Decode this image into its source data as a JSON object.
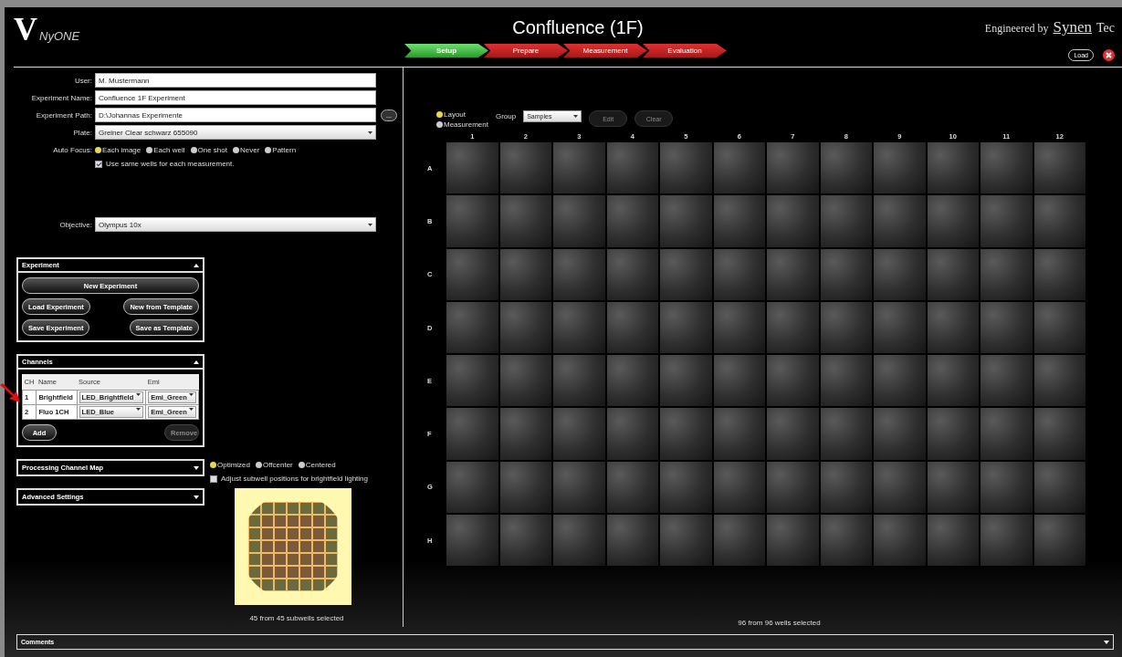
{
  "header": {
    "logo_mark": "V",
    "logo": "NyONE",
    "title": "Confluence (1F)",
    "brand_prefix": "Engineered by",
    "brand_first": "Synen",
    "brand_second": "Tec",
    "load_button": "Load"
  },
  "steps": [
    {
      "label": "Setup",
      "selected": true
    },
    {
      "label": "Prepare",
      "selected": false
    },
    {
      "label": "Measurement",
      "selected": false
    },
    {
      "label": "Evaluation",
      "selected": false
    }
  ],
  "form": {
    "fields": [
      {
        "label": "User:",
        "value": "M. Mustermann",
        "kind": "text"
      },
      {
        "label": "Experiment Name:",
        "value": "Confluence 1F Experiment",
        "kind": "text"
      },
      {
        "label": "Experiment Path:",
        "value": "D:\\Johannas Experimente",
        "kind": "path",
        "button": "..."
      },
      {
        "label": "Plate:",
        "value": "Greiner Clear schwarz 655090",
        "kind": "select"
      }
    ],
    "auto_focus": {
      "label": "Auto Focus:",
      "options": [
        {
          "label": "Each image",
          "selected": true
        },
        {
          "label": "Each well",
          "selected": false
        },
        {
          "label": "One shot",
          "selected": false
        },
        {
          "label": "Never",
          "selected": false
        },
        {
          "label": "Pattern",
          "selected": false
        }
      ]
    },
    "same_wells": {
      "label": "Use same wells for each measurement.",
      "checked": true
    },
    "objective": {
      "label": "Objective:",
      "value": "Olympus 10x"
    }
  },
  "experiment_panel": {
    "title": "Experiment",
    "expanded": true,
    "buttons": [
      "New Experiment",
      "Load Experiment",
      "New from Template",
      "Save Experiment",
      "Save as Template"
    ]
  },
  "channels_panel": {
    "title": "Channels",
    "expanded": true,
    "columns": [
      "CH",
      "Name",
      "Source",
      "Emi"
    ],
    "rows": [
      {
        "ch": "1",
        "name": "Brightfield",
        "source": "LED_Brightfield",
        "emi": "Emi_Green"
      },
      {
        "ch": "2",
        "name": "Fluo 1CH",
        "source": "LED_Blue",
        "emi": "Emi_Green"
      }
    ],
    "add": {
      "label": "Add"
    },
    "remove": {
      "label": "Remove",
      "disabled": true
    }
  },
  "collapsed_panels": [
    {
      "title": "Processing Channel Map",
      "expanded": false
    },
    {
      "title": "Advanced Settings",
      "expanded": false
    }
  ],
  "subwells": {
    "options": [
      {
        "label": "Optimized",
        "selected": true
      },
      {
        "label": "Offcenter",
        "selected": false
      },
      {
        "label": "Centered",
        "selected": false
      }
    ],
    "adjust": {
      "label": "Adjust subwell positions for brightfield lighting",
      "checked": false
    },
    "caption": "45 from 45 subwells selected"
  },
  "plate": {
    "modes": [
      {
        "label": "Layout",
        "selected": true
      },
      {
        "label": "Measurement",
        "selected": false
      }
    ],
    "group_label": "Group",
    "group_value": "Samples",
    "actions": [
      {
        "label": "Edit",
        "disabled": true
      },
      {
        "label": "Clear",
        "disabled": true
      }
    ],
    "columns": [
      "1",
      "2",
      "3",
      "4",
      "5",
      "6",
      "7",
      "8",
      "9",
      "10",
      "11",
      "12"
    ],
    "rows": [
      "A",
      "B",
      "C",
      "D",
      "E",
      "F",
      "G",
      "H"
    ],
    "caption": "96 from 96 wells selected"
  },
  "comments_panel": {
    "title": "Comments",
    "expanded": false
  }
}
